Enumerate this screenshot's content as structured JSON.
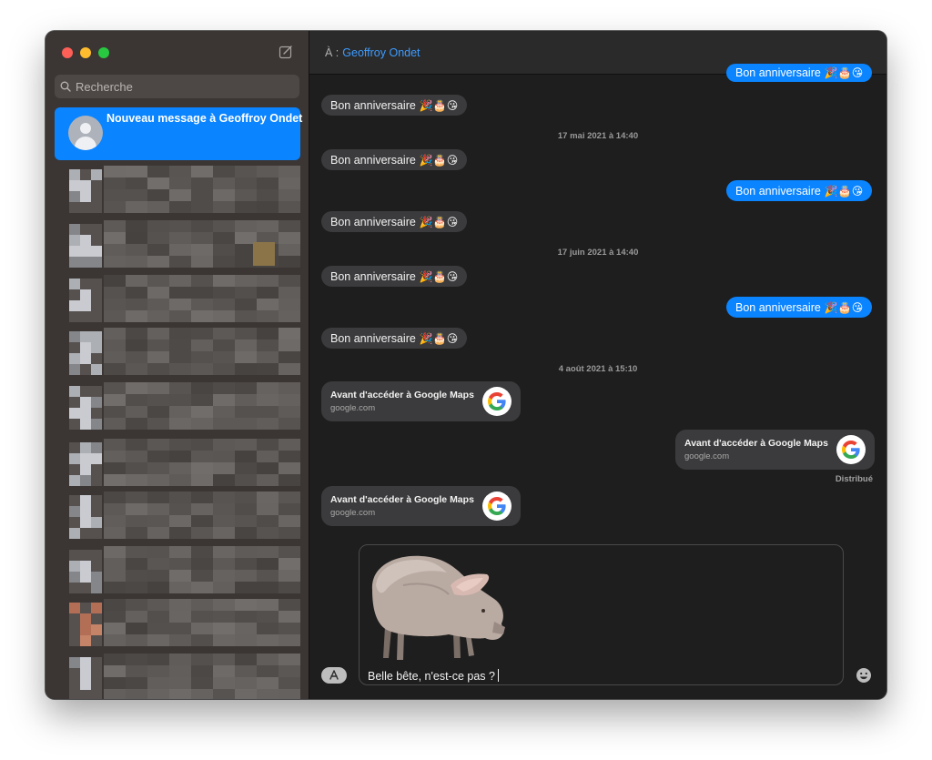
{
  "sidebar": {
    "search_placeholder": "Recherche",
    "selected_conversation_title": "Nouveau message à Geoffroy Ondet"
  },
  "header": {
    "to_label": "À :",
    "recipient": "Geoffroy Ondet"
  },
  "messages": {
    "bubble_text": "Bon anniversaire",
    "bubble_emoji": "🎉🎂😘",
    "stamp1": "17 mai 2021 à 14:40",
    "stamp2": "17 juin 2021 à 14:40",
    "stamp3": "4 août 2021 à 15:10",
    "link_title": "Avant d'accéder à Google Maps",
    "link_domain": "google.com",
    "status": "Distribué"
  },
  "composer": {
    "text": "Belle bête, n'est-ce pas ?"
  },
  "colors": {
    "accent": "#0a84ff",
    "sidebar_bg": "#3b3634",
    "chat_bg": "#1e1e1e",
    "incoming_bubble": "#3b3b3d"
  },
  "icons": [
    "compose-icon",
    "search-icon",
    "google-icon",
    "app-store-icon",
    "emoji-icon",
    "pig-image"
  ]
}
